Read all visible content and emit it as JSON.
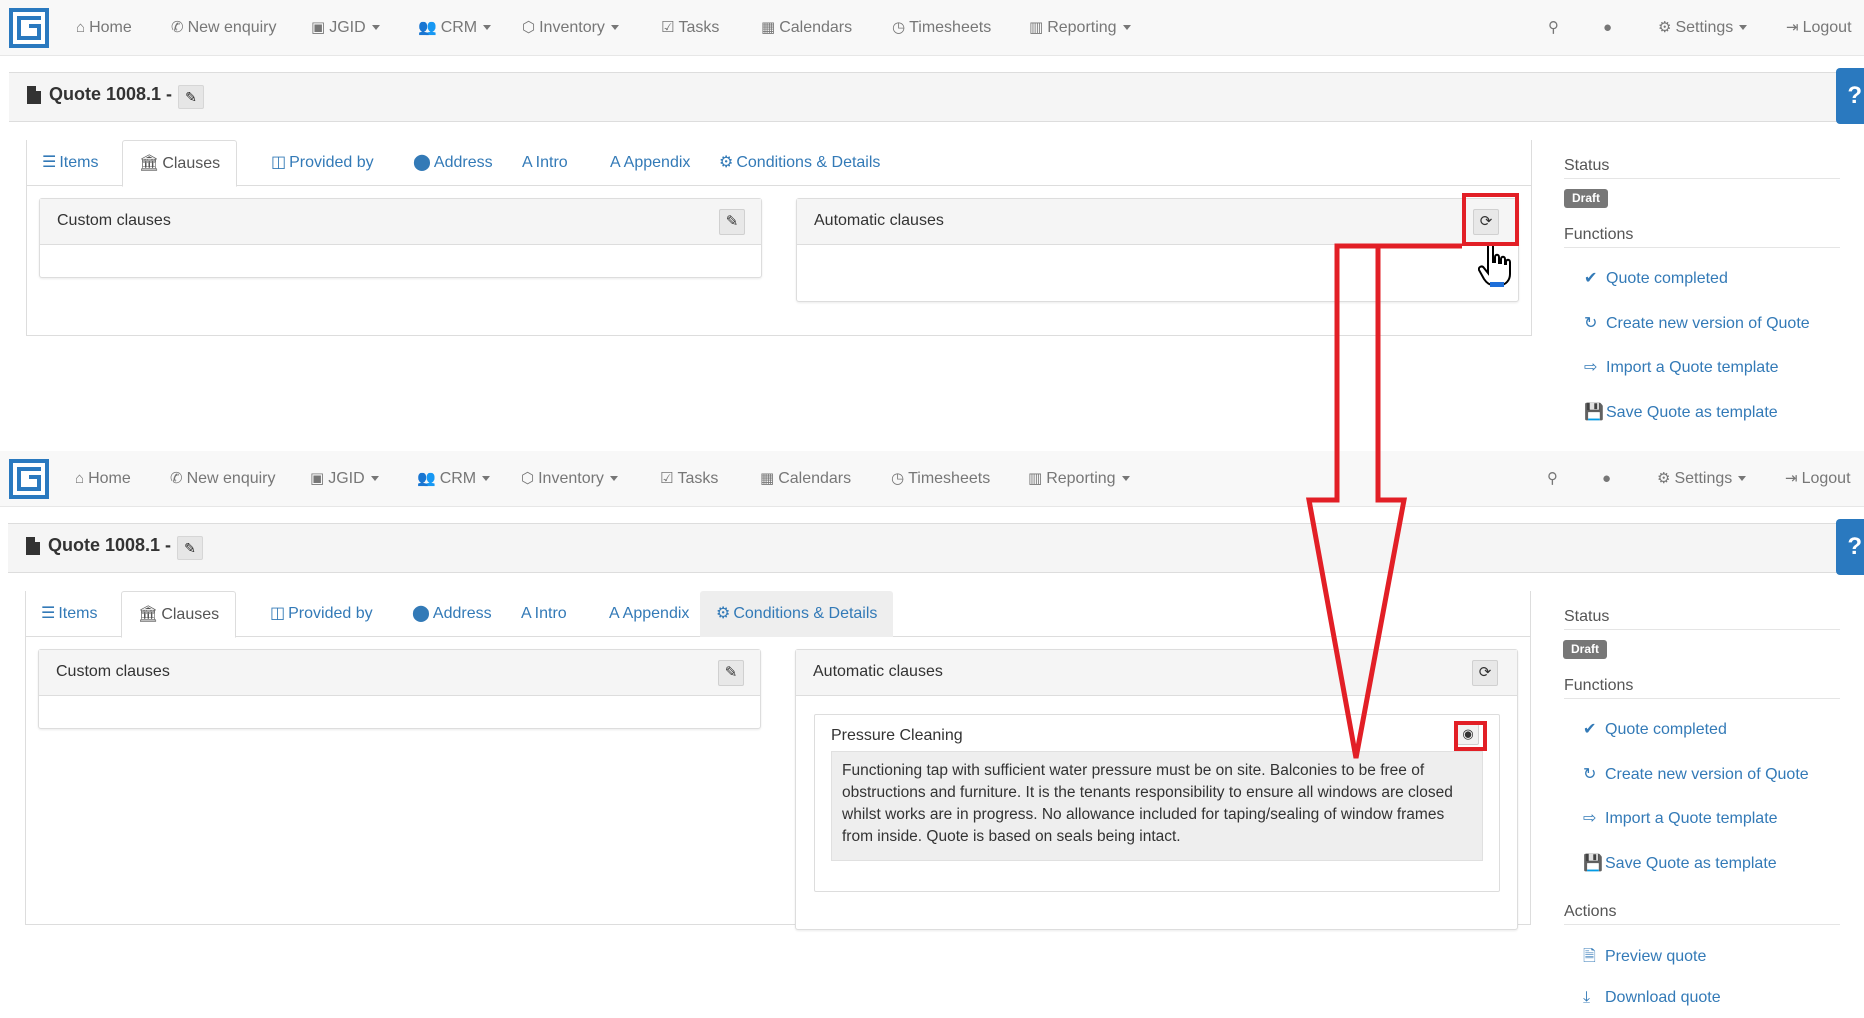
{
  "nav": {
    "items": [
      {
        "label": "Home",
        "icon": "home-icon"
      },
      {
        "label": "New enquiry",
        "icon": "phone-icon"
      },
      {
        "label": "JGID",
        "icon": "id-card-icon"
      },
      {
        "label": "CRM",
        "icon": "users-icon"
      },
      {
        "label": "Inventory",
        "icon": "cubes-icon"
      },
      {
        "label": "Tasks",
        "icon": "checkbox-icon"
      },
      {
        "label": "Calendars",
        "icon": "calendar-icon"
      },
      {
        "label": "Timesheets",
        "icon": "clock-icon"
      },
      {
        "label": "Reporting",
        "icon": "bar-chart-icon"
      }
    ],
    "right": [
      {
        "label": "",
        "icon": "search-icon"
      },
      {
        "label": "",
        "icon": "globe-icon"
      },
      {
        "label": "Settings",
        "icon": "gear-icon"
      },
      {
        "label": "Logout",
        "icon": "logout-icon"
      }
    ]
  },
  "page": {
    "title": "Quote 1008.1 -",
    "help": "?"
  },
  "tabs": [
    "Items",
    "Clauses",
    "Provided by",
    "Address",
    "Intro",
    "Appendix",
    "Conditions & Details"
  ],
  "panels": {
    "custom_title": "Custom clauses",
    "auto_title": "Automatic clauses"
  },
  "clause": {
    "title": "Pressure Cleaning",
    "text": "Functioning tap with sufficient water pressure must be on site. Balconies to be free of obstructions and furniture. It is the tenants responsibility to ensure all windows are closed whilst works are in progress. No allowance included for taping/sealing of window frames from inside. Quote is based on seals being intact."
  },
  "sidebar": {
    "status_label": "Status",
    "status_value": "Draft",
    "functions_label": "Functions",
    "functions": [
      "Quote completed",
      "Create new version of Quote",
      "Import a Quote template",
      "Save Quote as template"
    ],
    "actions_label": "Actions",
    "actions": [
      "Preview quote",
      "Download quote"
    ]
  },
  "colors": {
    "annotation_red": "#e21f26",
    "link_blue": "#337ab7",
    "brand_blue": "#2a79bf"
  }
}
